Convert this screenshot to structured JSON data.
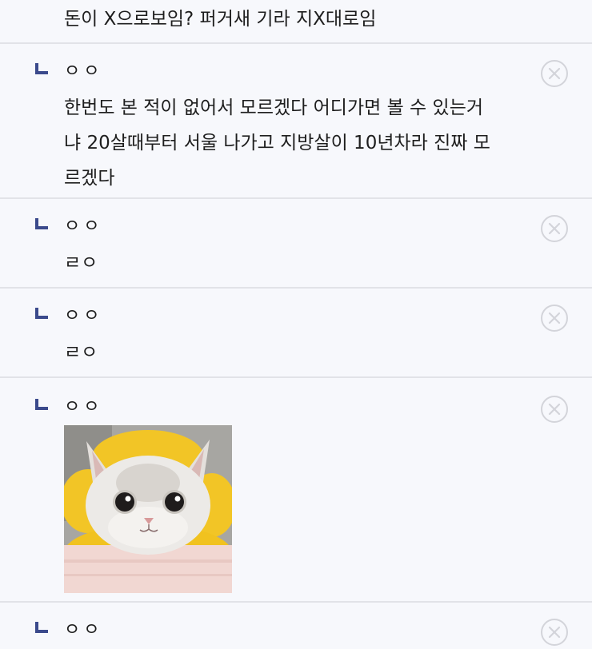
{
  "comments": {
    "top_text": "돈이 X으로보임? 퍼거새 기라 지X대로임",
    "c1": {
      "author": "ㅇㅇ",
      "text": "한번도 본 적이 없어서 모르겠다 어디가면 볼 수 있는거\n냐 20살때부터 서울 나가고 지방살이 10년차라 진짜 모\n르겠다"
    },
    "c2": {
      "author": "ㅇㅇ",
      "text": "ㄹㅇ"
    },
    "c3": {
      "author": "ㅇㅇ",
      "text": "ㄹㅇ"
    },
    "c4": {
      "author": "ㅇㅇ",
      "image": "cat-photo"
    },
    "c5": {
      "author": "ㅇㅇ"
    }
  },
  "icons": {
    "reply": "reply-arrow-icon",
    "delete": "delete-circle-x-icon"
  },
  "colors": {
    "background": "#f7f8fc",
    "divider": "#e2e3e8",
    "reply_mark": "#3b4a8c",
    "delete_icon": "#d3d4da",
    "text": "#1e1e1e"
  }
}
